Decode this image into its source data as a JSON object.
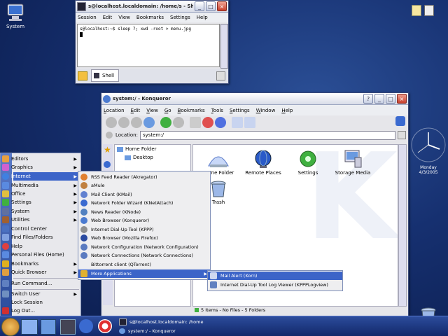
{
  "desktop": {
    "system_label": "System"
  },
  "clock": {
    "date": "Monday\n4/3/2005"
  },
  "shell_window": {
    "title": "s@localhost.localdomain: /home/s - Shell - Konsole",
    "menu": [
      "Session",
      "Edit",
      "View",
      "Bookmarks",
      "Settings",
      "Help"
    ],
    "command": "s@localhost:~$ sleep 7; xwd -root > menu.jpg",
    "tab_label": "Shell"
  },
  "konq_window": {
    "title": "system:/ - Konqueror",
    "menu": [
      "Location",
      "Edit",
      "View",
      "Go",
      "Bookmarks",
      "Tools",
      "Settings",
      "Window",
      "Help"
    ],
    "location_label": "Location:",
    "location_value": "system:/",
    "tree": [
      "Home Folder",
      "Desktop"
    ],
    "icons": [
      "Home Folder",
      "Remote Places",
      "Settings",
      "Storage Media",
      "Trash"
    ],
    "status": "5 Items - No Files - 5 Folders",
    "watermark": "K"
  },
  "start_menu": {
    "items": [
      "Editors",
      "Graphics",
      "Internet",
      "Multimedia",
      "Office",
      "Settings",
      "System",
      "Utilities",
      "Control Center",
      "Find Files/Folders",
      "Help",
      "Personal Files (Home)",
      "Bookmarks",
      "Quick Browser",
      "Run Command...",
      "Switch User",
      "Lock Session",
      "Log Out..."
    ]
  },
  "internet_menu": {
    "items": [
      "RSS Feed Reader (Akregator)",
      "aMule",
      "Mail Client (KMail)",
      "Network Folder Wizard (KNetAttach)",
      "News Reader (KNode)",
      "Web Browser (Konqueror)",
      "Internet Dial-Up Tool (KPPP)",
      "Web Browser (Mozilla Firefox)",
      "Network Configuration (Network Configuration)",
      "Network Connections (Network Connections)",
      "Bittorrent client (QTorrent)",
      "More Applications"
    ]
  },
  "more_apps_menu": {
    "items": [
      "Mail Alert (Korn)",
      "Internet Dial-Up Tool Log Viewer (KPPPLogview)"
    ]
  },
  "taskbar": {
    "tasks": [
      "s@localhost.localdomain: /home",
      "system:/ - Konqueror"
    ]
  },
  "colors": {
    "highlight": "#3c64c8",
    "desktop": "#163070"
  }
}
